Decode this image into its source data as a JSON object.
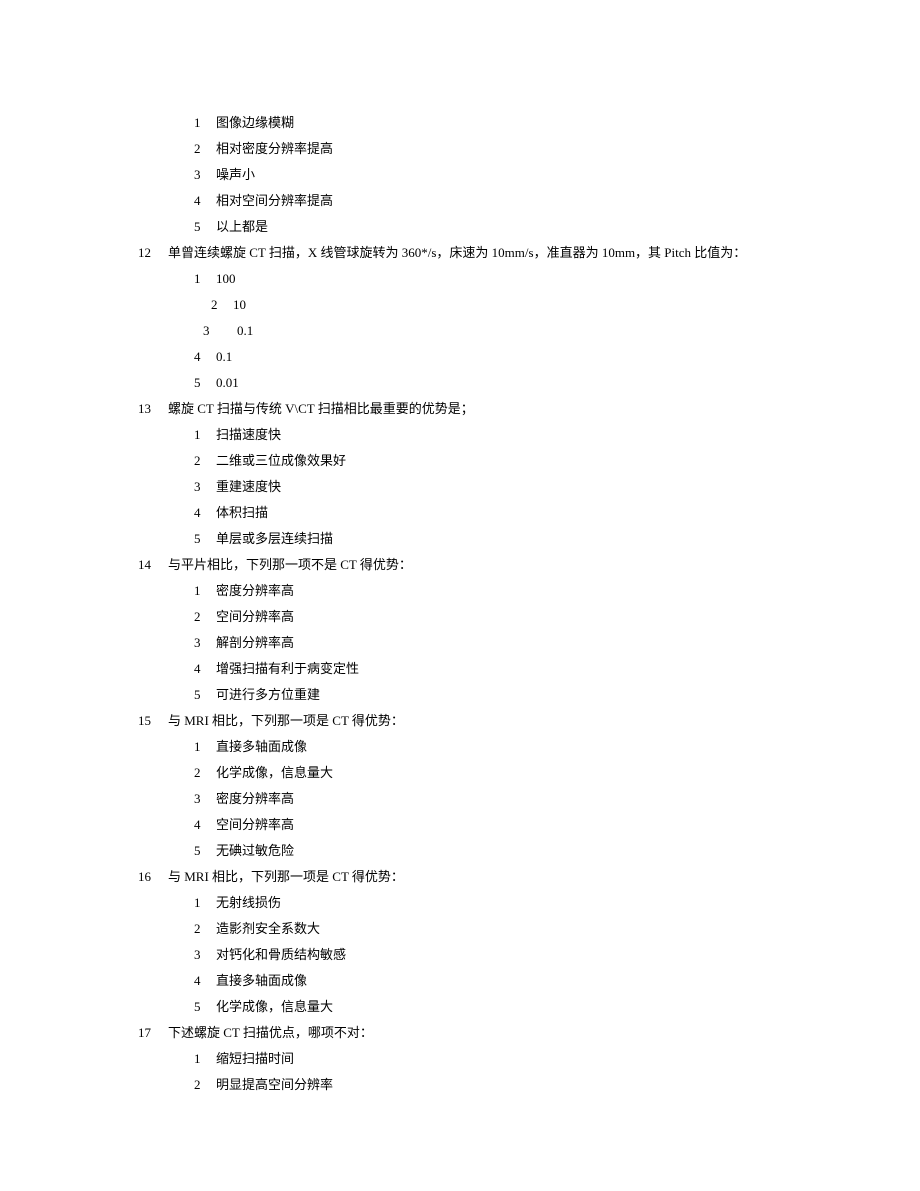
{
  "orphan_options": [
    {
      "num": "1",
      "text": "图像边缘模糊"
    },
    {
      "num": "2",
      "text": "相对密度分辨率提高"
    },
    {
      "num": "3",
      "text": "噪声小"
    },
    {
      "num": "4",
      "text": "相对空间分辨率提高"
    },
    {
      "num": "5",
      "text": "以上都是"
    }
  ],
  "questions": [
    {
      "num": "12",
      "text": "单曾连续螺旋 CT 扫描，X 线管球旋转为 360*/s，床速为 10mm/s，准直器为 10mm，其 Pitch 比值为：",
      "options": [
        {
          "num": "1",
          "text": "100",
          "indent": 0
        },
        {
          "num": "2",
          "text": "10",
          "indent": 1
        },
        {
          "num": "3",
          "text": "0.1",
          "indent": 2
        },
        {
          "num": "4",
          "text": "0.1",
          "indent": 0
        },
        {
          "num": "5",
          "text": "0.01",
          "indent": 0
        }
      ]
    },
    {
      "num": "13",
      "text": "螺旋 CT 扫描与传统 V\\CT 扫描相比最重要的优势是；",
      "options": [
        {
          "num": "1",
          "text": "扫描速度快",
          "indent": 0
        },
        {
          "num": "2",
          "text": "二维或三位成像效果好",
          "indent": 0
        },
        {
          "num": "3",
          "text": "重建速度快",
          "indent": 0
        },
        {
          "num": "4",
          "text": "体积扫描",
          "indent": 0
        },
        {
          "num": "5",
          "text": "单层或多层连续扫描",
          "indent": 0
        }
      ]
    },
    {
      "num": "14",
      "text": "与平片相比，下列那一项不是 CT 得优势：",
      "options": [
        {
          "num": "1",
          "text": "密度分辨率高",
          "indent": 0
        },
        {
          "num": "2",
          "text": "空间分辨率高",
          "indent": 0
        },
        {
          "num": "3",
          "text": "解剖分辨率高",
          "indent": 0
        },
        {
          "num": "4",
          "text": "增强扫描有利于病变定性",
          "indent": 0
        },
        {
          "num": "5",
          "text": "可进行多方位重建",
          "indent": 0
        }
      ]
    },
    {
      "num": "15",
      "text": "与 MRI 相比，下列那一项是 CT 得优势：",
      "options": [
        {
          "num": "1",
          "text": "直接多轴面成像",
          "indent": 0
        },
        {
          "num": "2",
          "text": "化学成像，信息量大",
          "indent": 0
        },
        {
          "num": "3",
          "text": "密度分辨率高",
          "indent": 0
        },
        {
          "num": "4",
          "text": "空间分辨率高",
          "indent": 0
        },
        {
          "num": "5",
          "text": "无碘过敏危险",
          "indent": 0
        }
      ]
    },
    {
      "num": "16",
      "text": "与 MRI 相比，下列那一项是 CT 得优势：",
      "options": [
        {
          "num": "1",
          "text": "无射线损伤",
          "indent": 0
        },
        {
          "num": "2",
          "text": "造影剂安全系数大",
          "indent": 0
        },
        {
          "num": "3",
          "text": "对钙化和骨质结构敏感",
          "indent": 0
        },
        {
          "num": "4",
          "text": "直接多轴面成像",
          "indent": 0
        },
        {
          "num": "5",
          "text": "化学成像，信息量大",
          "indent": 0
        }
      ]
    },
    {
      "num": "17",
      "text": "下述螺旋 CT 扫描优点，哪项不对：",
      "options": [
        {
          "num": "1",
          "text": "缩短扫描时间",
          "indent": 0
        },
        {
          "num": "2",
          "text": "明显提高空间分辨率",
          "indent": 0
        }
      ]
    }
  ]
}
